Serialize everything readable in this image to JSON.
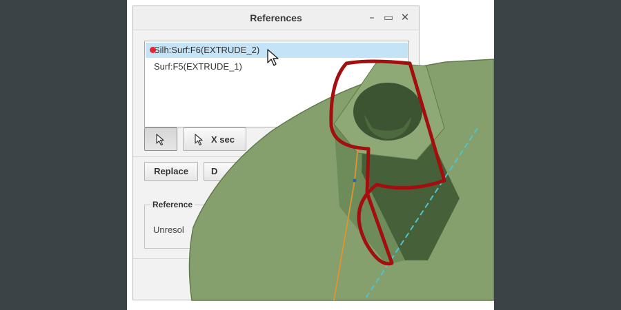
{
  "dialog": {
    "title": "References",
    "list_items": [
      {
        "label": "Silh:Surf:F6(EXTRUDE_2)",
        "selected": true,
        "marker_color": "#e5242b"
      },
      {
        "label": "Surf:F5(EXTRUDE_1)",
        "selected": false
      }
    ],
    "tools": {
      "select_icon": "pointer-icon",
      "xsec_label": "X sec"
    },
    "buttons": {
      "replace_label": "Replace",
      "second_label": "D"
    },
    "reference_group": {
      "title": "Reference",
      "value": "Unresol"
    }
  },
  "colors": {
    "background": "#3b4346",
    "selection": "#c5e3f7",
    "model_surface": "#85a06d",
    "highlight_edge": "#a30f0f",
    "axis_dash": "#4fc4d0",
    "datum_line": "#e0952e"
  }
}
